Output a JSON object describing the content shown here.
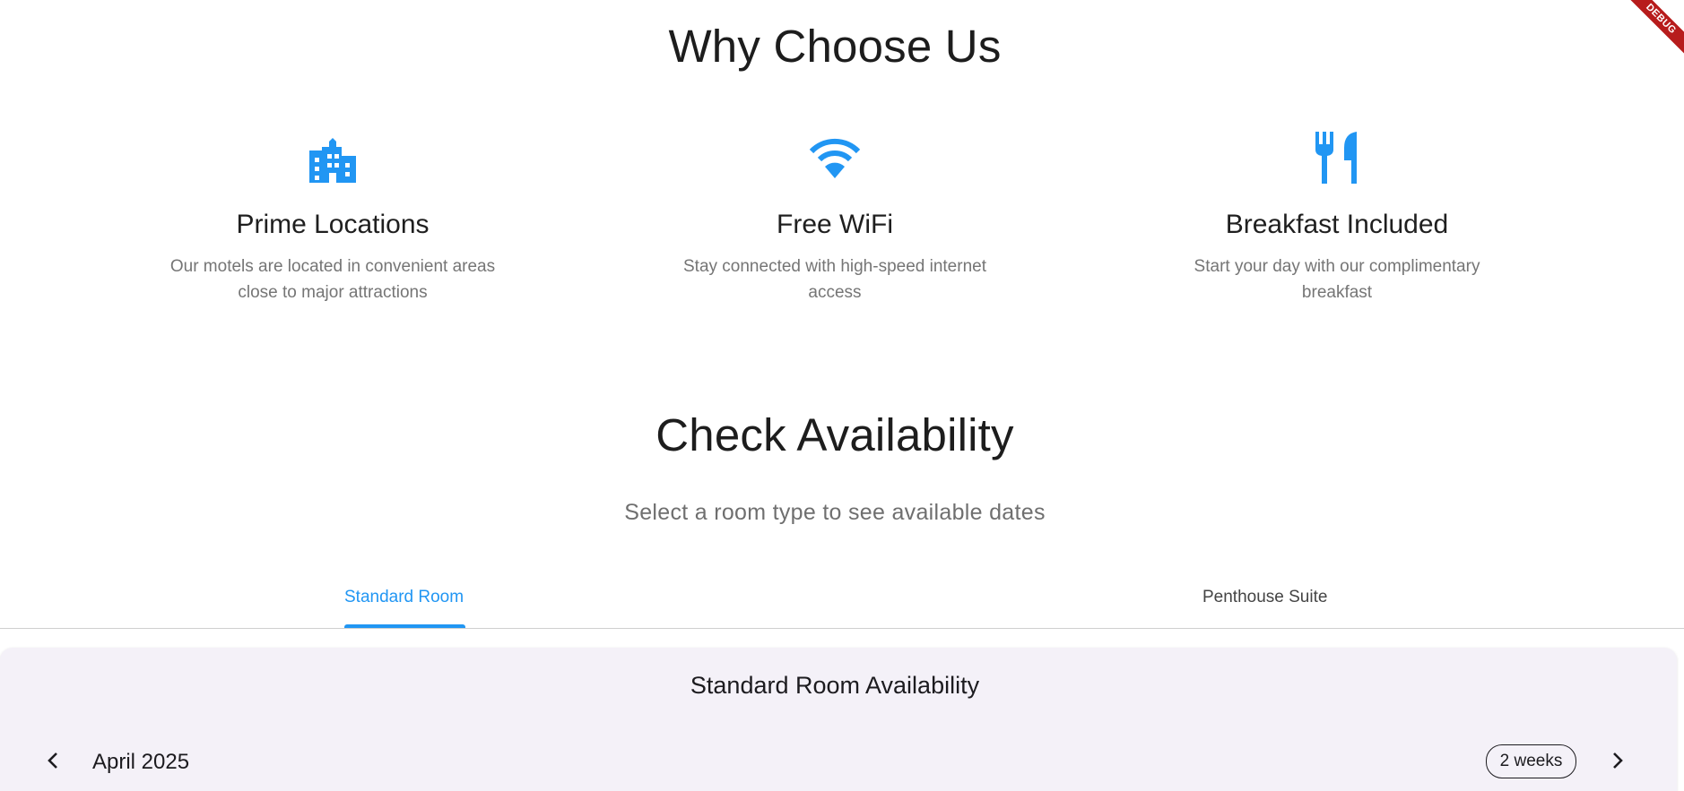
{
  "why_section": {
    "title": "Why Choose Us",
    "features": [
      {
        "icon": "apartment-icon",
        "title": "Prime Locations",
        "description": "Our motels are located in convenient areas close to major attractions"
      },
      {
        "icon": "wifi-icon",
        "title": "Free WiFi",
        "description": "Stay connected with high-speed internet access"
      },
      {
        "icon": "restaurant-icon",
        "title": "Breakfast Included",
        "description": "Start your day with our complimentary breakfast"
      }
    ]
  },
  "availability_section": {
    "title": "Check Availability",
    "subtitle": "Select a room type to see available dates",
    "tabs": [
      {
        "label": "Standard Room",
        "selected": true
      },
      {
        "label": "Penthouse Suite",
        "selected": false
      }
    ],
    "card": {
      "title": "Standard Room Availability",
      "month_label": "April 2025",
      "range_chip": "2 weeks",
      "prev_icon": "chevron-left-icon",
      "next_icon": "chevron-right-icon"
    }
  },
  "debug_banner": "DEBUG",
  "colors": {
    "accent": "#2196f3",
    "card_background": "#f4f1f8",
    "muted_text": "#757575",
    "debug_banner": "#b71c1c"
  }
}
